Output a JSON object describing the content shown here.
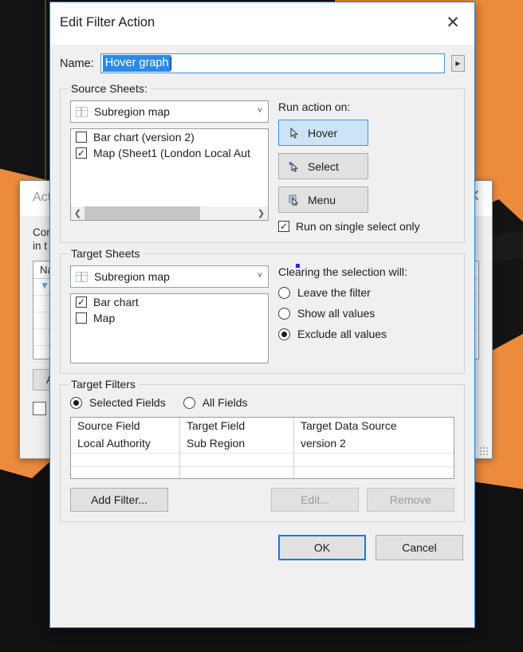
{
  "background": {
    "actions_dialog": {
      "title": "Actions",
      "body_line_1": "Con",
      "body_line_2": "in t",
      "list_header": "Na",
      "filter_icon": "filter-icon",
      "add_button": "Ad",
      "close_icon": "close-icon",
      "resize_grip": "resize-grip-icon"
    }
  },
  "dialog": {
    "title": "Edit Filter Action",
    "close_icon": "close-icon",
    "name": {
      "label": "Name:",
      "value": "Hover graph",
      "dropdown_icon": "chevron-right-icon"
    },
    "source_sheets": {
      "legend": "Source Sheets:",
      "combo_value": "Subregion map",
      "combo_icon": "worksheet-grid-icon",
      "combo_arrow_icon": "chevron-down-icon",
      "items": [
        {
          "label": "Bar chart (version 2)",
          "checked": false
        },
        {
          "label": "Map (Sheet1 (London Local Aut",
          "checked": true
        }
      ],
      "scroll_left_icon": "chevron-left-icon",
      "scroll_right_icon": "chevron-right-icon"
    },
    "run_action": {
      "label": "Run action on:",
      "buttons": [
        {
          "label": "Hover",
          "icon": "cursor-arrow-icon",
          "selected": true
        },
        {
          "label": "Select",
          "icon": "cursor-select-icon",
          "selected": false
        },
        {
          "label": "Menu",
          "icon": "cursor-menu-icon",
          "selected": false
        }
      ],
      "single_select_label": "Run on single select only",
      "single_select_checked": true
    },
    "target_sheets": {
      "legend": "Target Sheets",
      "combo_value": "Subregion map",
      "combo_icon": "worksheet-grid-icon",
      "combo_arrow_icon": "chevron-down-icon",
      "items": [
        {
          "label": "Bar chart",
          "checked": true
        },
        {
          "label": "Map",
          "checked": false
        }
      ]
    },
    "clearing": {
      "label": "Clearing the selection will:",
      "options": [
        {
          "label": "Leave the filter",
          "selected": false
        },
        {
          "label": "Show all values",
          "selected": false
        },
        {
          "label": "Exclude all values",
          "selected": true
        }
      ]
    },
    "target_filters": {
      "legend": "Target Filters",
      "scope_options": [
        {
          "label": "Selected Fields",
          "selected": true
        },
        {
          "label": "All Fields",
          "selected": false
        }
      ],
      "columns": [
        "Source Field",
        "Target Field",
        "Target Data Source"
      ],
      "rows": [
        [
          "Local Authority",
          "Sub Region",
          "version 2"
        ]
      ],
      "buttons": [
        {
          "label": "Add Filter...",
          "enabled": true
        },
        {
          "label": "Edit...",
          "enabled": false
        },
        {
          "label": "Remove",
          "enabled": false
        }
      ]
    },
    "footer": {
      "ok_label": "OK",
      "cancel_label": "Cancel"
    }
  }
}
